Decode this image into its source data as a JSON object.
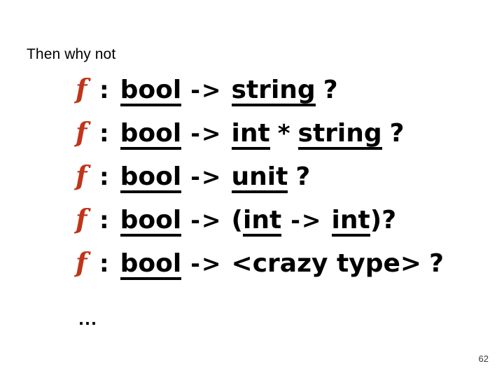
{
  "slide": {
    "heading": "Then why not",
    "ellipsis": "...",
    "page_number": "62",
    "background_color": "#ffffff",
    "function_name_color": "#C0351A",
    "text_color": "#000000"
  },
  "signatures": [
    {
      "fn": "f",
      "colon": ":",
      "tokens": [
        {
          "text": "bool",
          "underline": true,
          "kind": "type"
        },
        {
          "text": "->",
          "underline": false,
          "kind": "arrow"
        },
        {
          "text": "string",
          "underline": true,
          "kind": "type"
        },
        {
          "text": "?",
          "underline": false,
          "kind": "qmark"
        }
      ],
      "plain": "f : bool -> string ?"
    },
    {
      "fn": "f",
      "colon": ":",
      "tokens": [
        {
          "text": "bool",
          "underline": true,
          "kind": "type"
        },
        {
          "text": "->",
          "underline": false,
          "kind": "arrow"
        },
        {
          "text": "int",
          "underline": true,
          "kind": "type"
        },
        {
          "text": "*",
          "underline": false,
          "kind": "star"
        },
        {
          "text": "string",
          "underline": true,
          "kind": "type"
        },
        {
          "text": "?",
          "underline": false,
          "kind": "qmark"
        }
      ],
      "plain": "f : bool -> int * string ?"
    },
    {
      "fn": "f",
      "colon": ":",
      "tokens": [
        {
          "text": "bool",
          "underline": true,
          "kind": "type"
        },
        {
          "text": "->",
          "underline": false,
          "kind": "arrow"
        },
        {
          "text": "unit",
          "underline": true,
          "kind": "type"
        },
        {
          "text": "?",
          "underline": false,
          "kind": "qmark"
        }
      ],
      "plain": "f : bool -> unit ?"
    },
    {
      "fn": "f",
      "colon": ":",
      "tokens": [
        {
          "text": "bool",
          "underline": true,
          "kind": "type"
        },
        {
          "text": "->",
          "underline": false,
          "kind": "arrow"
        },
        {
          "text": "(",
          "underline": false,
          "kind": "paren-open"
        },
        {
          "text": "int",
          "underline": true,
          "kind": "type"
        },
        {
          "text": "->",
          "underline": false,
          "kind": "arrow"
        },
        {
          "text": "int",
          "underline": true,
          "kind": "tight"
        },
        {
          "text": ")",
          "underline": false,
          "kind": "paren-close"
        },
        {
          "text": "?",
          "underline": false,
          "kind": "qmark"
        }
      ],
      "plain": "f : bool -> (int -> int) ?"
    },
    {
      "fn": "f",
      "colon": ":",
      "tokens": [
        {
          "text": "bool",
          "underline": true,
          "kind": "type"
        },
        {
          "text": "->",
          "underline": false,
          "kind": "arrow"
        },
        {
          "text": "<crazy type>",
          "underline": false,
          "kind": "generic"
        },
        {
          "text": "?",
          "underline": false,
          "kind": "qmark"
        }
      ],
      "plain": "f : bool -> <crazy type> ?"
    }
  ]
}
